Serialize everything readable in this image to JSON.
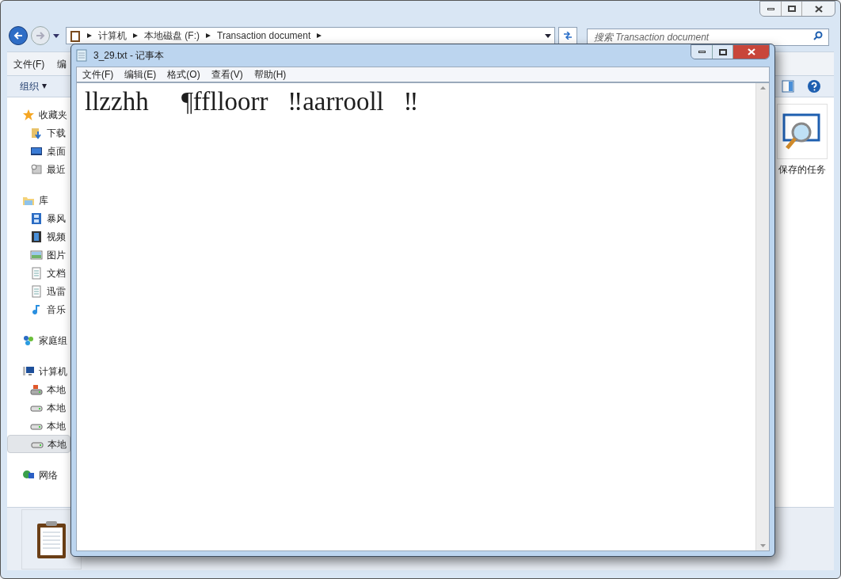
{
  "explorer": {
    "breadcrumb": [
      "计算机",
      "本地磁盘 (F:)",
      "Transaction document"
    ],
    "search": {
      "placeholder": "搜索 Transaction document"
    },
    "menu": [
      "文件(F)",
      "编"
    ],
    "toolbar": {
      "organize": "组织"
    },
    "sidebar": [
      {
        "label": "收藏夹",
        "selected": false,
        "children": [
          {
            "label": "下载",
            "selected": false
          },
          {
            "label": "桌面",
            "selected": false
          },
          {
            "label": "最近",
            "selected": false
          }
        ]
      },
      {
        "label": "库",
        "selected": false,
        "children": [
          {
            "label": "暴风",
            "selected": false
          },
          {
            "label": "视频",
            "selected": false
          },
          {
            "label": "图片",
            "selected": false
          },
          {
            "label": "文档",
            "selected": false
          },
          {
            "label": "迅雷",
            "selected": false
          },
          {
            "label": "音乐",
            "selected": false
          }
        ]
      },
      {
        "label": "家庭组",
        "selected": false
      },
      {
        "label": "计算机",
        "selected": false,
        "children": [
          {
            "label": "本地",
            "selected": false
          },
          {
            "label": "本地",
            "selected": false
          },
          {
            "label": "本地",
            "selected": false
          },
          {
            "label": "本地",
            "selected": true
          }
        ]
      },
      {
        "label": "网络",
        "selected": false
      }
    ],
    "items": [
      {
        "label": "保存的任务"
      }
    ]
  },
  "notepad": {
    "title": "3_29.txt - 记事本",
    "menu": [
      "文件(F)",
      "编辑(E)",
      "格式(O)",
      "查看(V)",
      "帮助(H)"
    ],
    "content": "llzzhh     ¶fflloorr   ‼aarrooll   ‼"
  }
}
